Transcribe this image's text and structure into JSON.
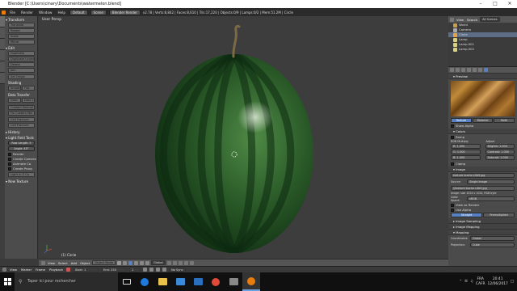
{
  "window": {
    "title": "Blender [C:\\Users\\cinary\\Documents\\watermelon.blend]"
  },
  "info": {
    "menus": [
      "File",
      "Render",
      "Window",
      "Help"
    ],
    "layout": "Default",
    "scene": "Scene",
    "engine": "Blender Render",
    "stats": "v2.78 | Verts:8,842 | Faces:8,610 | Tris:17,220 | Objects:0/9 | Lamps:0/2 | Mem:51.2M | Circle"
  },
  "toolshelf": {
    "sections": {
      "transform": "Transform",
      "edit": "Edit",
      "history": "History",
      "shading": "Shading",
      "data_transfer": "Data Transfer",
      "grease": "Grease Pencil"
    },
    "transform_buttons": [
      "Translate",
      "Rotate",
      "Scale",
      "Mirror"
    ],
    "edit_buttons": [
      "Duplicate",
      "Duplicate Linked",
      "Delete",
      "Join"
    ],
    "set_origin": "Set Origin",
    "shading_buttons": [
      "Smooth",
      "Flat"
    ],
    "data_buttons": [
      "Data",
      "Data Lay"
    ],
    "more_buttons": [
      "Custom Normal",
      "Fix Custom Nor",
      "Cell Fracture",
      "Cell Fracture"
    ],
    "light_field_label": "Light Field Tools",
    "row_length_label": "Row Length: 5",
    "angle_label": "Angle: 45°",
    "checks": [
      "Render",
      "Create Camera",
      "Animate Ca",
      "Create Proxy"
    ],
    "bottom_label": "Light in Z Ca",
    "new_texture": "New Texture"
  },
  "viewport": {
    "label": "User Persp",
    "object_label": "(1) Circle",
    "header": {
      "menus": [
        "View",
        "Select",
        "Add",
        "Object"
      ],
      "mode": "Object Mode",
      "pivot": "Global"
    }
  },
  "outliner": {
    "view": "View",
    "search": "Search",
    "all_scenes": "All Scenes",
    "items": [
      {
        "label": "World",
        "selected": false
      },
      {
        "label": "Camera",
        "selected": false
      },
      {
        "label": "Circle",
        "selected": true
      },
      {
        "label": "Lamp",
        "selected": false
      },
      {
        "label": "Lamp.001",
        "selected": false
      },
      {
        "label": "Lamp.002",
        "selected": false
      }
    ]
  },
  "properties": {
    "preview": "Preview",
    "tabs": [
      "Texture",
      "Material",
      "Both"
    ],
    "show_alpha": "Show Alpha",
    "colors": "Colors",
    "ramp": "Ramp",
    "rgb_mult": "RGB Multiply",
    "adjust": "Adjust",
    "r": "R:   1.000",
    "g": "G:   1.000",
    "b": "B:   1.000",
    "brightness": "Brightn: 1.000",
    "contrast": "Contrast: 1.000",
    "saturation": "Saturati: 1.000",
    "clamp": "Clamp",
    "image_section": "Image",
    "image_file": "texture bucho c4b5.jpg",
    "source_label": "Source:",
    "source_value": "Single Image",
    "filepath": "//texture bucho c4b5.jpg",
    "image_info": "Image: size 1024 x 1024, RGB byte",
    "color_space_label": "Color Space:",
    "color_space": "sRGB",
    "view_as_render": "View as Render",
    "use_alpha": "Use Alpha",
    "alpha_options": [
      "Straight",
      "Premultiplied"
    ],
    "sampling": "Image Sampling",
    "mapping_img": "Image Mapping",
    "mapping": "Mapping",
    "coordinates_label": "Coordinates:",
    "coordinates": "Global",
    "projection_label": "Projection:",
    "projection": "Cube"
  },
  "timeline": {
    "menus": [
      "View",
      "Marker",
      "Frame",
      "Playback"
    ],
    "start": "Start:   1",
    "end": "End: 250",
    "current": "1",
    "sync": "No Sync"
  },
  "taskbar": {
    "search_placeholder": "Taper ici pour rechercher",
    "language": "FRA",
    "language_sub": "CAFR",
    "time": "20:41",
    "date": "12/06/2017"
  },
  "colors": {
    "accent": "#5680c2",
    "melon_dark": "#10301a",
    "melon_light": "#2e6b2f"
  }
}
